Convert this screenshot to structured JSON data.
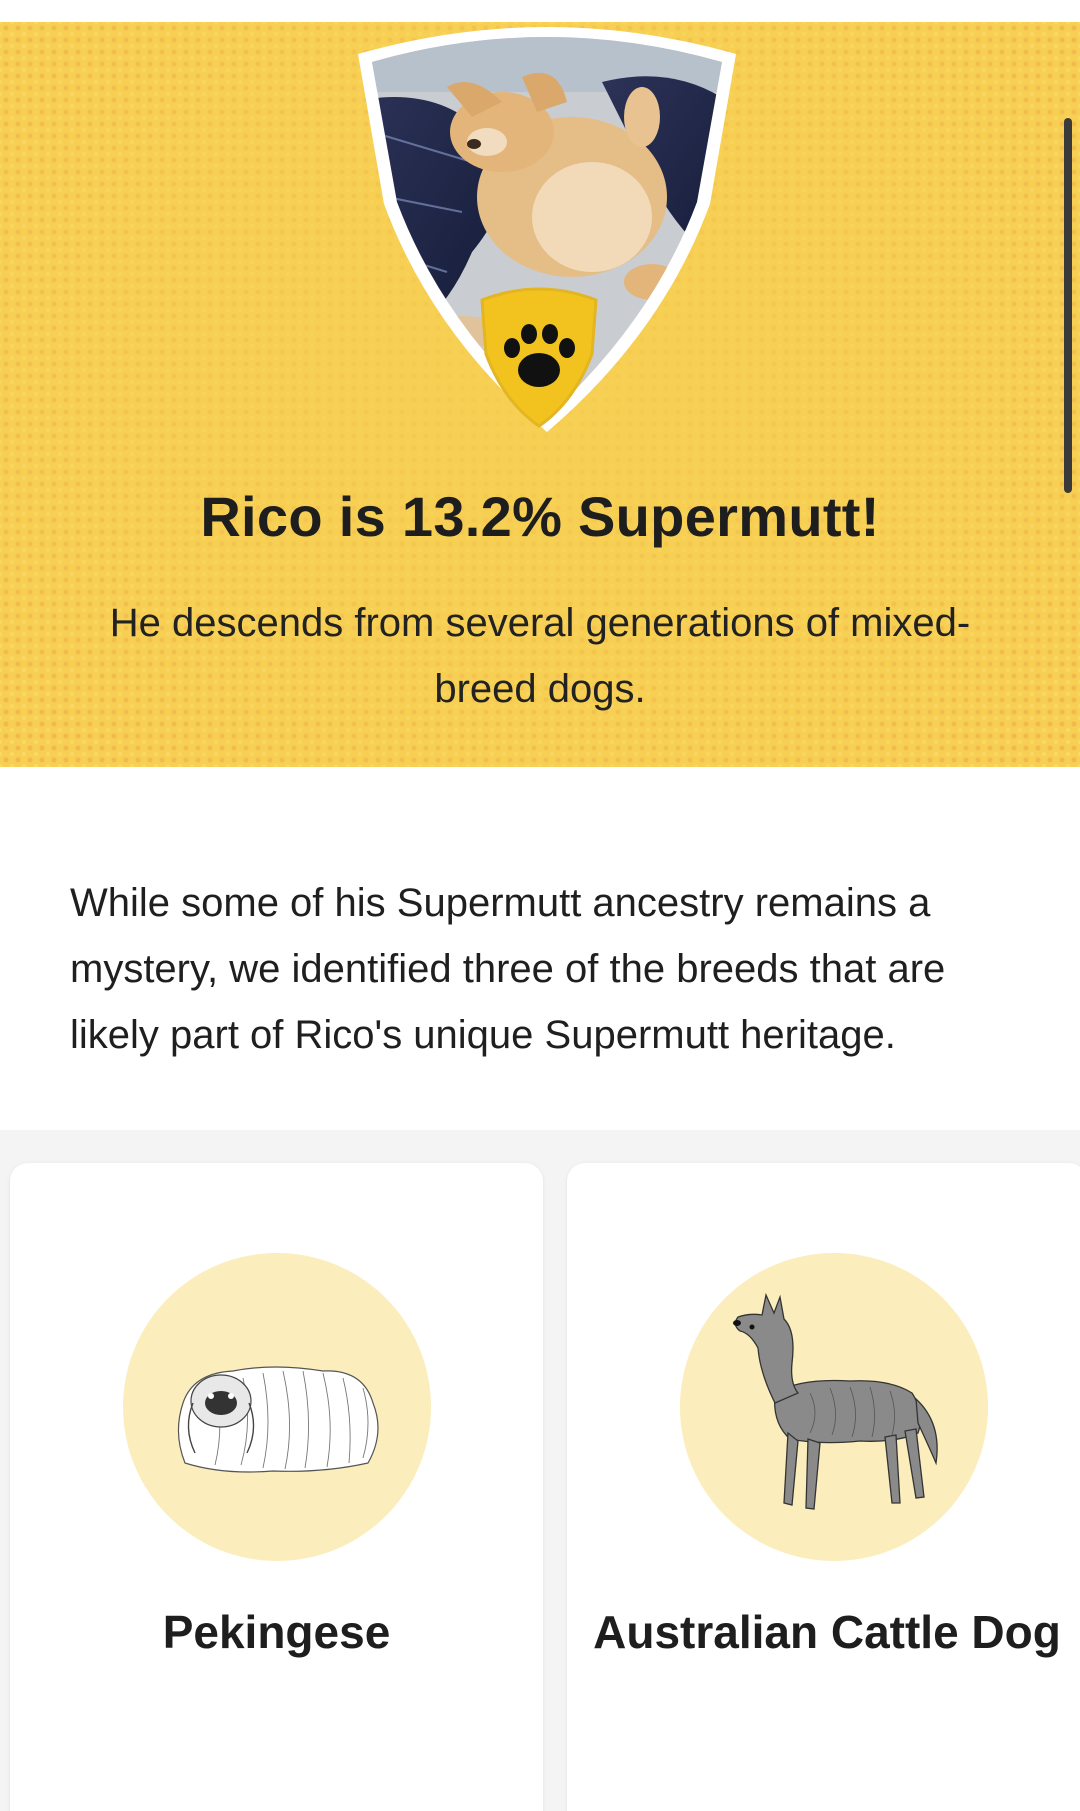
{
  "hero": {
    "title": "Rico is 13.2% Supermutt!",
    "subtitle": "He descends from several generations of mixed-breed dogs.",
    "pet_photo_icon": "pet-photo-shield",
    "badge_icon": "paw-icon"
  },
  "intro": {
    "text": "While some of his Supermutt ancestry remains a mystery, we identified three of the breeds that are likely part of Rico's unique Supermutt heritage."
  },
  "breeds": [
    {
      "name": "Pekingese",
      "icon": "pekingese-illustration"
    },
    {
      "name": "Australian Cattle Dog",
      "icon": "australian-cattle-dog-illustration"
    }
  ],
  "colors": {
    "hero_background": "#f6cf53",
    "breed_circle": "#fbedbc",
    "text": "#1f1f1f"
  }
}
